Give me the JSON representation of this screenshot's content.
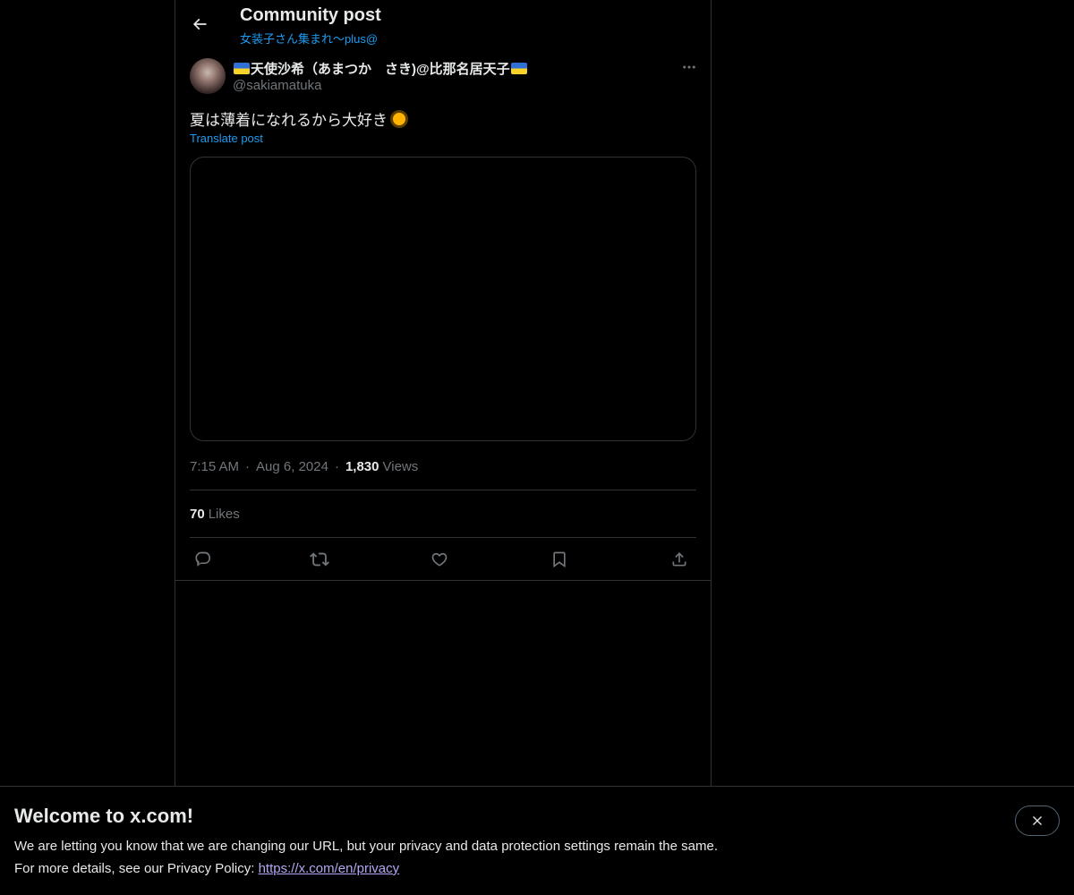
{
  "header": {
    "title": "Community post",
    "community": "女装子さん集まれ〜plus@"
  },
  "post": {
    "author_name": "天使沙希（あまつか　さき)@比那名居天子",
    "handle": "@sakiamatuka",
    "text": "夏は薄着になれるから大好き",
    "translate_label": "Translate post",
    "time": "7:15 AM",
    "date": "Aug 6, 2024",
    "views_count": "1,830",
    "views_label": "Views",
    "likes_count": "70",
    "likes_label": "Likes",
    "separator": "·"
  },
  "actions": [
    "reply-icon",
    "repost-icon",
    "like-icon",
    "bookmark-icon",
    "share-icon"
  ],
  "banner": {
    "title": "Welcome to x.com!",
    "line1": "We are letting you know that we are changing our URL, but your privacy and data protection settings remain the same.",
    "line2_prefix": "For more details, see our Privacy Policy: ",
    "link": "https://x.com/en/privacy"
  },
  "colors": {
    "accent": "#1d9bf0",
    "link": "#b3a8f5",
    "muted": "#71767b",
    "border": "#2f3336"
  }
}
